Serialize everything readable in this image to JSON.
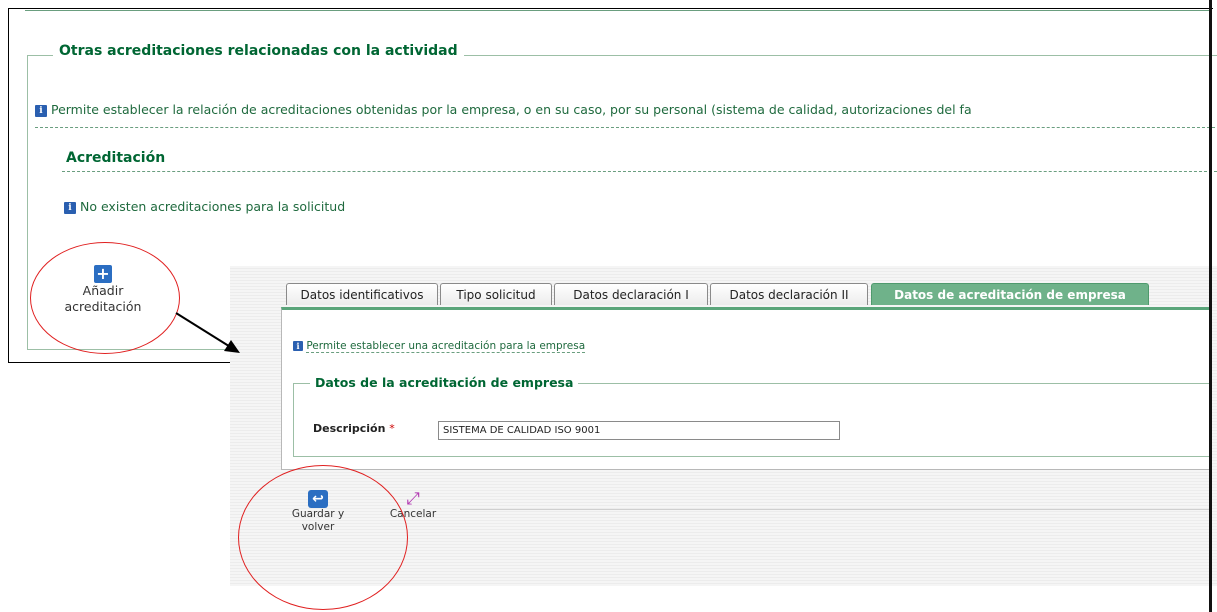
{
  "top": {
    "section_legend": "Otras acreditaciones relacionadas con la actividad",
    "info_text": "Permite establecer la relación de acreditaciones obtenidas por la empresa, o en su caso, por su personal (sistema de calidad, autorizaciones del fa",
    "subheading": "Acreditación",
    "empty_text": "No existen acreditaciones para la solicitud",
    "add_button_line1": "Añadir",
    "add_button_line2": "acreditación"
  },
  "form": {
    "tabs": [
      {
        "label": "Datos identificativos"
      },
      {
        "label": "Tipo solicitud"
      },
      {
        "label": "Datos declaración I"
      },
      {
        "label": "Datos declaración II"
      },
      {
        "label": "Datos de acreditación de empresa"
      }
    ],
    "active_tab": "Datos de acreditación de empresa",
    "info_text": "Permite establecer una acreditación para la empresa",
    "fieldset_legend": "Datos de la acreditación de empresa",
    "description_label": "Descripción",
    "required_mark": "*",
    "description_value": "SISTEMA DE CALIDAD ISO 9001",
    "save_line1": "Guardar y",
    "save_line2": "volver",
    "cancel_label": "Cancelar"
  },
  "icons": {
    "info": "info-icon",
    "add": "plus-icon",
    "save": "return-arrow-icon",
    "cancel": "cancel-icon"
  },
  "colors": {
    "heading_green": "#006633",
    "active_tab": "#6fb28a",
    "annotation_red": "#e02020",
    "icon_blue": "#2b6ec2"
  }
}
